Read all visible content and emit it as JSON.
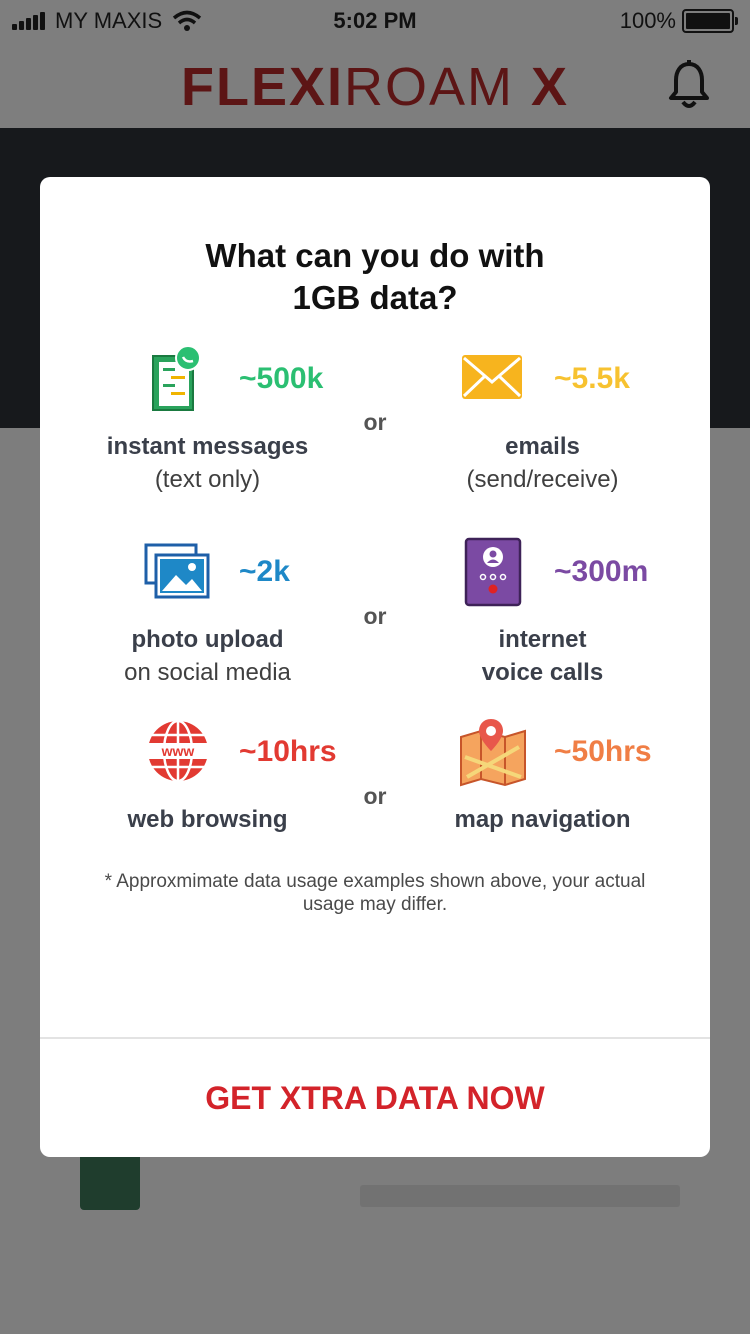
{
  "status_bar": {
    "carrier": "MY MAXIS",
    "time": "5:02 PM",
    "battery": "100%"
  },
  "header": {
    "logo_bold": "FLEXI",
    "logo_light": "ROAM",
    "logo_x": "X"
  },
  "modal": {
    "title_line1": "What can you do with",
    "title_line2": "1GB data?",
    "separator": "or",
    "items": [
      {
        "value": "~500k",
        "label_line1": "instant messages",
        "label_line2": "(text only)",
        "color": "#2bbf72",
        "icon": "whatsapp-chat-icon"
      },
      {
        "value": "~5.5k",
        "label_line1": "emails",
        "label_line2": "(send/receive)",
        "color": "#f7c230",
        "icon": "envelope-icon"
      },
      {
        "value": "~2k",
        "label_line1": "photo upload",
        "label_line2": "on social media",
        "color": "#1e88c7",
        "icon": "photos-icon"
      },
      {
        "value": "~300m",
        "label_line1": "internet",
        "label_line2": "voice calls",
        "color": "#7b4aa3",
        "icon": "voice-call-phone-icon"
      },
      {
        "value": "~10hrs",
        "label_line1": "web browsing",
        "label_line2": "",
        "color": "#e23a32",
        "icon": "www-globe-icon"
      },
      {
        "value": "~50hrs",
        "label_line1": "map navigation",
        "label_line2": "",
        "color": "#f07e45",
        "icon": "map-pin-icon"
      }
    ],
    "footnote": "* Approxmimate data usage examples shown above, your actual usage may differ.",
    "cta": "GET XTRA DATA NOW"
  },
  "colors": {
    "cta": "#d3232a",
    "overlay": "#7d7d7d",
    "brand": "#5c1515"
  }
}
